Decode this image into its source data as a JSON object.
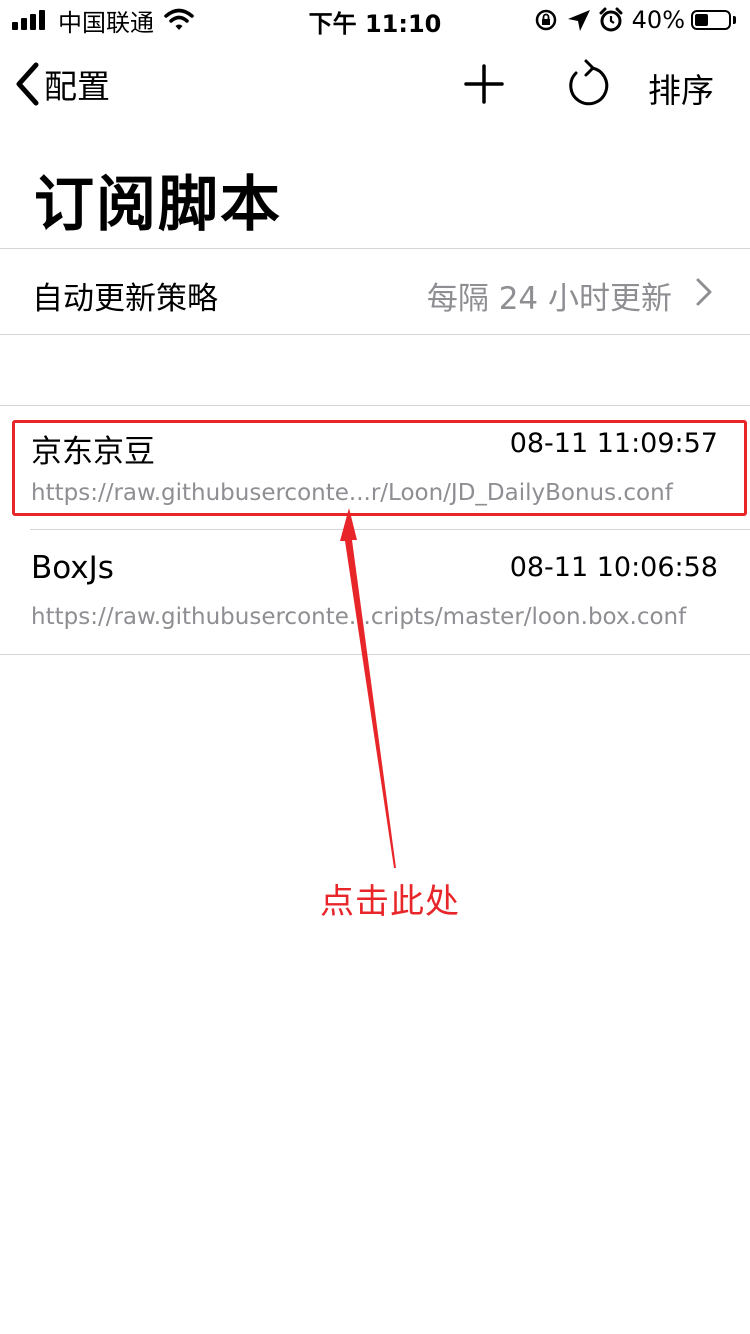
{
  "status_bar": {
    "carrier": "中国联通",
    "time": "下午 11:10",
    "battery_percent_text": "40%",
    "battery_level": 0.4,
    "icons": [
      "signal-icon",
      "wifi-icon",
      "rotation-lock-icon",
      "location-icon",
      "alarm-icon",
      "battery-icon"
    ]
  },
  "nav": {
    "back_label": "配置",
    "sort_label": "排序",
    "icons": [
      "back-chevron-icon",
      "plus-icon",
      "refresh-icon"
    ]
  },
  "page_title": "订阅脚本",
  "settings": {
    "auto_update_label": "自动更新策略",
    "auto_update_value": "每隔 24 小时更新"
  },
  "scripts": [
    {
      "name": "京东京豆",
      "time": "08-11 11:09:57",
      "url": "https://raw.githubuserconte...r/Loon/JD_DailyBonus.conf"
    },
    {
      "name": "BoxJs",
      "time": "08-11 10:06:58",
      "url": "https://raw.githubuserconte...cripts/master/loon.box.conf"
    }
  ],
  "annotation": {
    "label": "点击此处",
    "color": "#e8262a"
  },
  "colors": {
    "secondary_text": "#8e8e93",
    "separator": "#d4d4d8"
  }
}
